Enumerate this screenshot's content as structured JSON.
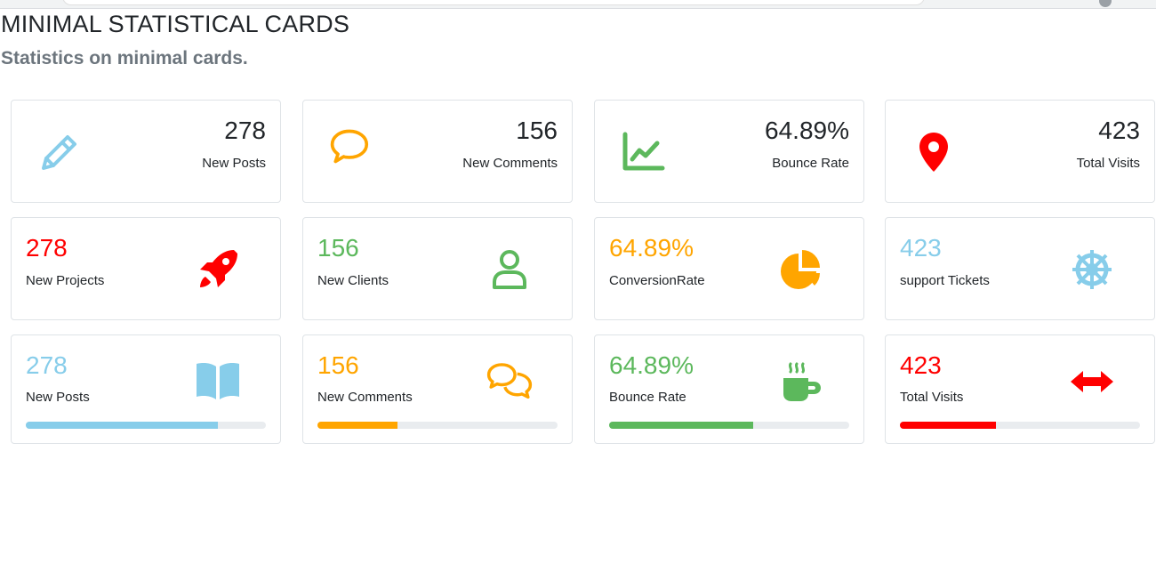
{
  "header": {
    "title": "MINIMAL STATISTICAL CARDS",
    "subtitle": "Statistics on minimal cards."
  },
  "colors": {
    "blue": "#87cdea",
    "orange": "#ffa500",
    "green": "#5cb85c",
    "red": "#ff0000",
    "progress_track": "#e9ecef"
  },
  "row1": [
    {
      "value": "278",
      "label": "New Posts",
      "icon": "pencil-icon",
      "color": "#87cdea"
    },
    {
      "value": "156",
      "label": "New Comments",
      "icon": "speech-bubble-icon",
      "color": "#ffa500"
    },
    {
      "value": "64.89%",
      "label": "Bounce Rate",
      "icon": "line-chart-icon",
      "color": "#5cb85c"
    },
    {
      "value": "423",
      "label": "Total Visits",
      "icon": "map-pin-icon",
      "color": "#ff0000"
    }
  ],
  "row2": [
    {
      "value": "278",
      "label": "New Projects",
      "icon": "rocket-icon",
      "color": "#ff0000"
    },
    {
      "value": "156",
      "label": "New Clients",
      "icon": "user-icon",
      "color": "#5cb85c"
    },
    {
      "value": "64.89%",
      "label": "ConversionRate",
      "icon": "pie-chart-icon",
      "color": "#ffa500"
    },
    {
      "value": "423",
      "label": "support Tickets",
      "icon": "life-ring-icon",
      "color": "#87cdea"
    }
  ],
  "row3": [
    {
      "value": "278",
      "label": "New Posts",
      "icon": "book-open-icon",
      "color": "#87cdea",
      "progress": 0.8
    },
    {
      "value": "156",
      "label": "New Comments",
      "icon": "comments-icon",
      "color": "#ffa500",
      "progress": 0.335
    },
    {
      "value": "64.89%",
      "label": "Bounce Rate",
      "icon": "coffee-cup-icon",
      "color": "#5cb85c",
      "progress": 0.6
    },
    {
      "value": "423",
      "label": "Total Visits",
      "icon": "arrows-horizontal-icon",
      "color": "#ff0000",
      "progress": 0.4
    }
  ]
}
